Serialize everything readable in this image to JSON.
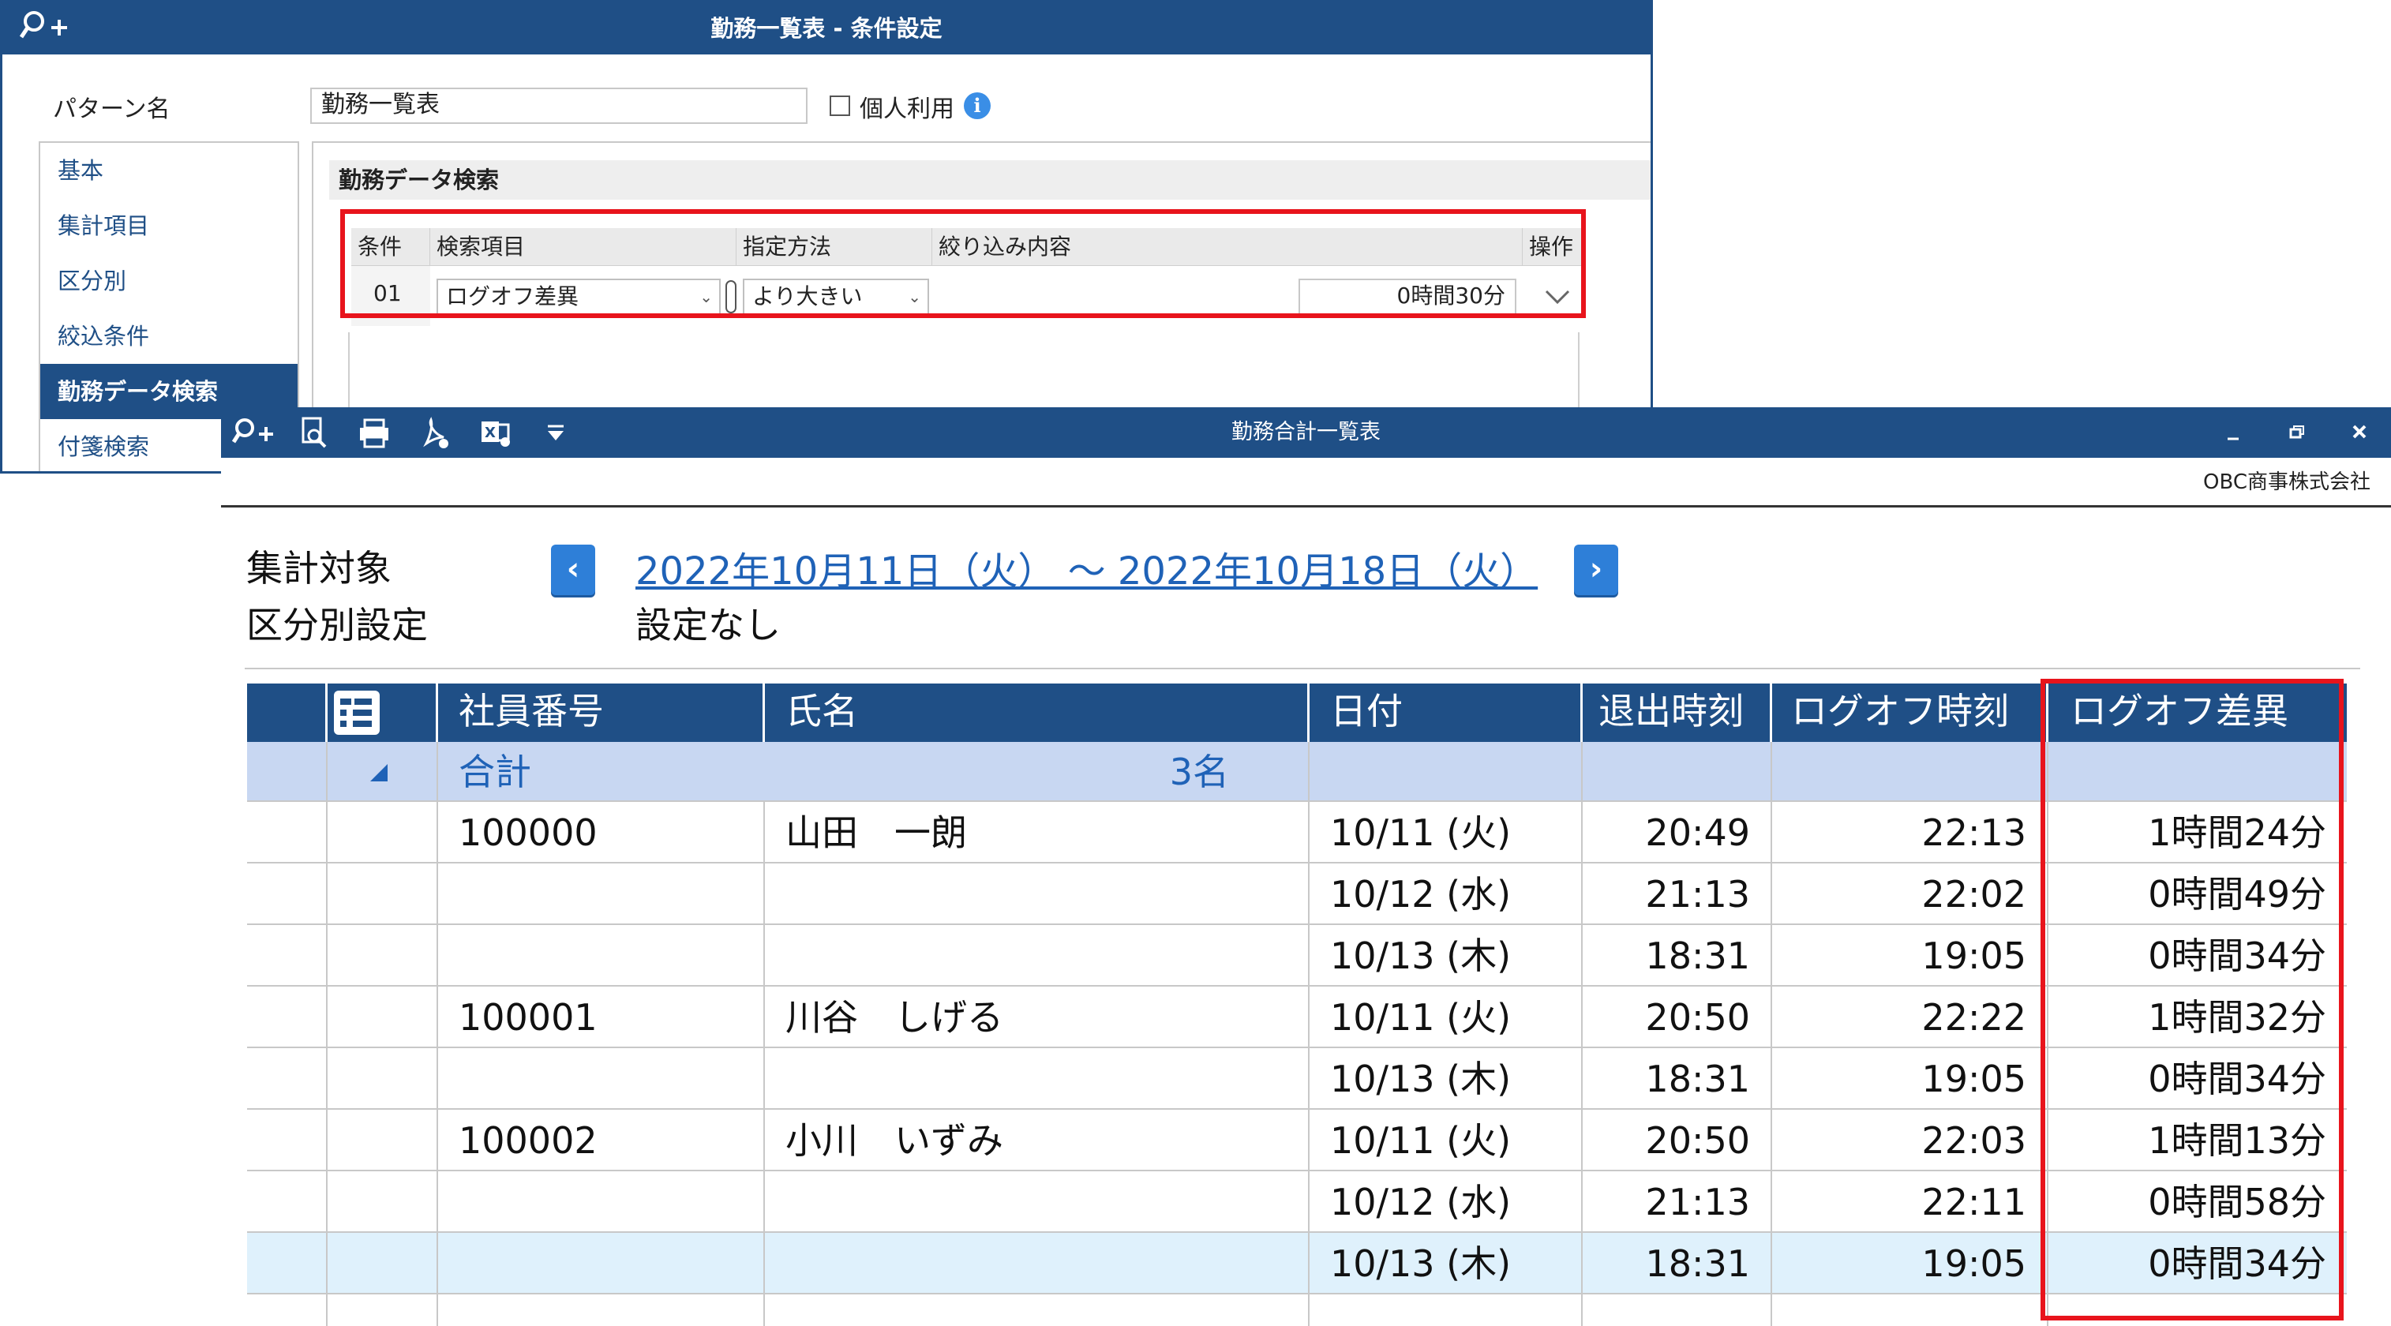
{
  "window1": {
    "title": "勤務一覧表 - 条件設定",
    "pattern_label": "パターン名",
    "pattern_value": "勤務一覧表",
    "personal_use_label": "個人利用",
    "info_icon": "i",
    "nav_items": [
      "基本",
      "集計項目",
      "区分別",
      "絞込条件",
      "勤務データ検索",
      "付箋検索"
    ],
    "section_title": "勤務データ検索",
    "table_headers": [
      "条件",
      "検索項目",
      "指定方法",
      "絞り込み内容",
      "操作"
    ],
    "row": {
      "no": "01",
      "item": "ログオフ差異",
      "method": "より大きい",
      "value": "0時間30分"
    }
  },
  "window2": {
    "title": "勤務合計一覧表",
    "company": "OBC商事株式会社",
    "period_label": "集計対象",
    "setting_label": "区分別設定",
    "period": "2022年10月11日（火） ～ 2022年10月18日（火）",
    "setting": "設定なし",
    "headers": [
      "社員番号",
      "氏名",
      "日付",
      "退出時刻",
      "ログオフ時刻",
      "ログオフ差異"
    ],
    "total": {
      "label": "合計",
      "count": "3名"
    },
    "rows": [
      {
        "id": "100000",
        "name": "山田　一朗",
        "date": "10/11 (火)",
        "exit": "20:49",
        "logoff": "22:13",
        "diff": "1時間24分"
      },
      {
        "id": "",
        "name": "",
        "date": "10/12 (水)",
        "exit": "21:13",
        "logoff": "22:02",
        "diff": "0時間49分"
      },
      {
        "id": "",
        "name": "",
        "date": "10/13 (木)",
        "exit": "18:31",
        "logoff": "19:05",
        "diff": "0時間34分"
      },
      {
        "id": "100001",
        "name": "川谷　しげる",
        "date": "10/11 (火)",
        "exit": "20:50",
        "logoff": "22:22",
        "diff": "1時間32分"
      },
      {
        "id": "",
        "name": "",
        "date": "10/13 (木)",
        "exit": "18:31",
        "logoff": "19:05",
        "diff": "0時間34分"
      },
      {
        "id": "100002",
        "name": "小川　いずみ",
        "date": "10/11 (火)",
        "exit": "20:50",
        "logoff": "22:03",
        "diff": "1時間13分"
      },
      {
        "id": "",
        "name": "",
        "date": "10/12 (水)",
        "exit": "21:13",
        "logoff": "22:11",
        "diff": "0時間58分"
      },
      {
        "id": "",
        "name": "",
        "date": "10/13 (木)",
        "exit": "18:31",
        "logoff": "19:05",
        "diff": "0時間34分"
      }
    ]
  },
  "icons": {
    "search_add": "search-add-icon",
    "preview": "preview-icon",
    "print": "print-icon",
    "pdf": "pdf-icon",
    "excel": "excel-icon",
    "dropdown": "dropdown-icon",
    "minimize": "minimize-icon",
    "restore": "restore-icon",
    "close": "close-icon",
    "prev": "chevron-left-icon",
    "next": "chevron-right-icon",
    "tree": "tree-expand-icon",
    "collapse": "collapse-triangle-icon"
  },
  "colors": {
    "title_bar": "#1f4f86",
    "highlight_red": "#e8141c",
    "total_row": "#c8d7f2",
    "selected_row": "#dff1fc",
    "link": "#1f62b7"
  }
}
